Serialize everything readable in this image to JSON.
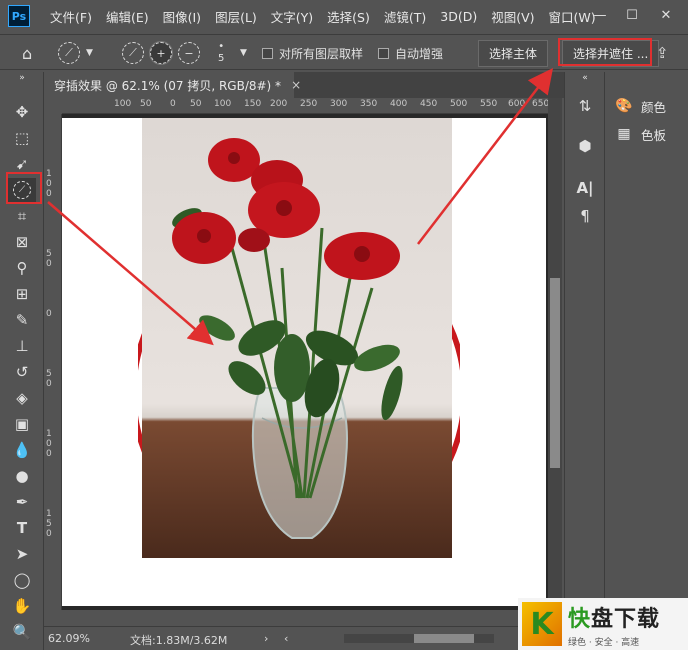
{
  "app": {
    "logo": "Ps"
  },
  "menu": [
    "文件(F)",
    "编辑(E)",
    "图像(I)",
    "图层(L)",
    "文字(Y)",
    "选择(S)",
    "滤镜(T)",
    "3D(D)",
    "视图(V)",
    "窗口(W)"
  ],
  "window_controls": {
    "minimize": "—",
    "maximize": "☐",
    "close": "✕"
  },
  "options": {
    "brush_size": "5",
    "sample_all_layers": "对所有图层取样",
    "auto_enhance": "自动增强",
    "select_subject": "选择主体",
    "select_and_mask": "选择并遮住 ..."
  },
  "document": {
    "tab_title": "穿插效果 @ 62.1% (07 拷贝, RGB/8#) *",
    "close": "×",
    "zoom": "62.09%",
    "doc_size": "文档:1.83M/3.62M"
  },
  "ruler": {
    "h_labels": [
      "100",
      "50",
      "0",
      "50",
      "100",
      "150",
      "200",
      "250",
      "300",
      "350",
      "400",
      "450",
      "500",
      "550",
      "600",
      "650"
    ],
    "v_labels": [
      [
        "1",
        "0",
        "0"
      ],
      [
        "5",
        "0"
      ],
      [
        "0"
      ],
      [
        "5",
        "0"
      ],
      [
        "1",
        "0",
        "0"
      ],
      [
        "1",
        "5",
        "0"
      ]
    ]
  },
  "panels": {
    "items": [
      {
        "icon": "palette-icon",
        "label": "颜色"
      },
      {
        "icon": "swatches-icon",
        "label": "色板"
      }
    ]
  },
  "watermark": {
    "title_green": "快",
    "title_rest": "盘下载",
    "subtitle": "绿色 · 安全 · 高速",
    "k": "K"
  },
  "colors": {
    "highlight": "#e03030",
    "arrow": "#e03030",
    "rose": "#c0141c",
    "circle": "#c8181c"
  }
}
